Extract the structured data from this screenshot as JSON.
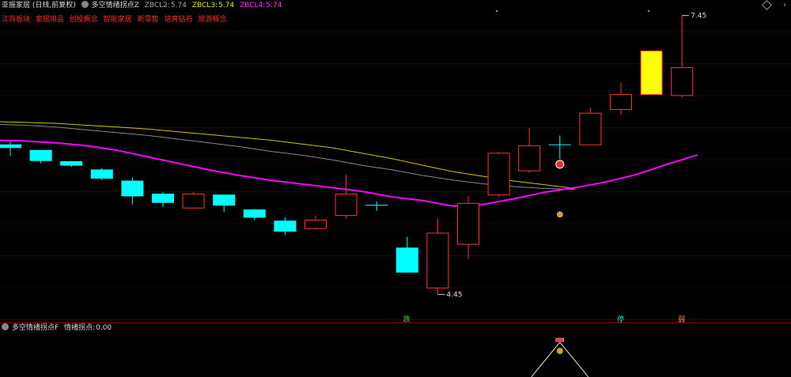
{
  "header": {
    "stock": "亚振家居 (日线,前复权)",
    "indicator": "多空情绪拐点Z",
    "zbcl2_label": "ZBCL2:",
    "zbcl2_value": "5.74",
    "zbcl3_label": "ZBCL3:",
    "zbcl3_value": "5.74",
    "zbcl4_label": "ZBCL4:",
    "zbcl4_value": "5.74"
  },
  "tags": [
    "江苏板块",
    "家居用品",
    "创投概念",
    "智能家居",
    "新零售",
    "培育钻石",
    "旅游概念"
  ],
  "sub_header": {
    "indicator": "多空情绪拐点F",
    "label": "情绪拐点:",
    "value": "0.00"
  },
  "colors": {
    "up": "#ff3232",
    "down": "#00ffff",
    "limit_up": "#ffff00",
    "ma_magenta": "#ff00ff",
    "ma_yellow": "#c8c800",
    "ma_gray": "#888888"
  },
  "chart_data": {
    "type": "candlestick",
    "ylim": [
      4.2,
      7.6
    ],
    "candles": [
      {
        "o": 6.06,
        "c": 6.03,
        "h": 6.1,
        "l": 5.94
      },
      {
        "o": 6.0,
        "c": 5.89,
        "h": 6.0,
        "l": 5.86
      },
      {
        "o": 5.88,
        "c": 5.84,
        "h": 5.88,
        "l": 5.82
      },
      {
        "o": 5.79,
        "c": 5.7,
        "h": 5.81,
        "l": 5.68
      },
      {
        "o": 5.67,
        "c": 5.51,
        "h": 5.71,
        "l": 5.42
      },
      {
        "o": 5.53,
        "c": 5.44,
        "h": 5.55,
        "l": 5.39
      },
      {
        "o": 5.38,
        "c": 5.53,
        "h": 5.55,
        "l": 5.37
      },
      {
        "o": 5.52,
        "c": 5.41,
        "h": 5.52,
        "l": 5.34
      },
      {
        "o": 5.36,
        "c": 5.28,
        "h": 5.37,
        "l": 5.25
      },
      {
        "o": 5.24,
        "c": 5.13,
        "h": 5.28,
        "l": 5.09
      },
      {
        "o": 5.16,
        "c": 5.25,
        "h": 5.3,
        "l": 5.15
      },
      {
        "o": 5.3,
        "c": 5.53,
        "h": 5.74,
        "l": 5.27
      },
      {
        "o": 5.41,
        "c": 5.41,
        "h": 5.45,
        "l": 5.35
      },
      {
        "o": 4.95,
        "c": 4.69,
        "h": 5.07,
        "l": 4.69
      },
      {
        "o": 4.52,
        "c": 5.11,
        "h": 5.26,
        "l": 4.45
      },
      {
        "o": 4.99,
        "c": 5.43,
        "h": 5.51,
        "l": 4.83
      },
      {
        "o": 5.52,
        "c": 5.97,
        "h": 5.98,
        "l": 5.5
      },
      {
        "o": 5.78,
        "c": 6.05,
        "h": 6.24,
        "l": 5.76
      },
      {
        "o": 6.06,
        "c": 6.06,
        "h": 6.16,
        "l": 5.91
      },
      {
        "o": 6.06,
        "c": 6.4,
        "h": 6.46,
        "l": 6.06
      },
      {
        "o": 6.44,
        "c": 6.6,
        "h": 6.73,
        "l": 6.38
      },
      {
        "o": 6.6,
        "c": 7.07,
        "h": 7.07,
        "l": 6.6
      },
      {
        "o": 6.59,
        "c": 6.89,
        "h": 7.45,
        "l": 6.57
      }
    ],
    "ma_magenta": [
      6.11,
      6.1,
      6.08,
      6.05,
      6.0,
      5.93,
      5.86,
      5.79,
      5.73,
      5.68,
      5.64,
      5.6,
      5.56,
      5.5,
      5.46,
      5.4,
      5.42,
      5.48,
      5.55,
      5.6,
      5.66,
      5.74,
      5.85,
      5.95
    ],
    "ma_yellow": [
      6.31,
      6.3,
      6.29,
      6.27,
      6.25,
      6.23,
      6.2,
      6.17,
      6.14,
      6.11,
      6.07,
      6.03,
      5.97,
      5.91,
      5.84,
      5.77,
      5.72,
      5.67,
      5.63,
      5.59
    ],
    "ma_gray": [
      6.28,
      6.27,
      6.25,
      6.22,
      6.19,
      6.16,
      6.12,
      6.08,
      6.04,
      5.99,
      5.95,
      5.9,
      5.84,
      5.79,
      5.73,
      5.68,
      5.64,
      5.61,
      5.59,
      5.58
    ],
    "annotations": [
      {
        "text": "7.45",
        "candle": 22,
        "value": 7.45
      },
      {
        "text": "4.45",
        "candle": 14,
        "value": 4.45
      }
    ],
    "bottom_markers": [
      {
        "text": "跌",
        "candle": 13,
        "color": "#33dd33"
      },
      {
        "text": "停",
        "candle": 20,
        "color": "#33dddd"
      },
      {
        "text": "弱",
        "candle": 22,
        "color": "#ff8844"
      }
    ]
  }
}
